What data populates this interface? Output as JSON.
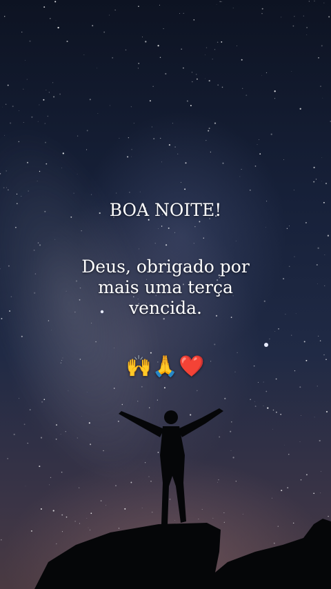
{
  "greeting": {
    "title": "BOA NOITE!",
    "message_lines": [
      "Deus, obrigado por",
      "mais uma terça",
      "vencida."
    ],
    "emojis": "🙌🙏❤️"
  },
  "colors": {
    "text": "#ffffff",
    "sky_top": "#0d1322",
    "sky_bottom": "#4a3a42",
    "silhouette": "#050608"
  }
}
